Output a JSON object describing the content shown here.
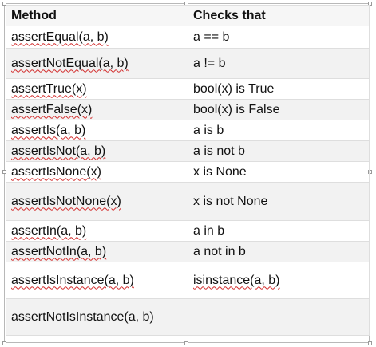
{
  "table": {
    "headers": [
      "Method",
      "Checks that"
    ],
    "rows": [
      {
        "method": "assertEqual(a, b)",
        "check": "a == b"
      },
      {
        "method": "assertNotEqual(a, b)",
        "check": "a != b"
      },
      {
        "method": "assertTrue(x)",
        "check": "bool(x) is True"
      },
      {
        "method": "assertFalse(x)",
        "check": "bool(x) is False"
      },
      {
        "method": "assertIs(a, b)",
        "check": "a is b"
      },
      {
        "method": "assertIsNot(a, b)",
        "check": "a is not b"
      },
      {
        "method": "assertIsNone(x)",
        "check": "x is None"
      },
      {
        "method": "assertIsNotNone(x)",
        "check": "x is not None"
      },
      {
        "method": "assertIn(a, b)",
        "check": "a in b"
      },
      {
        "method": "assertNotIn(a, b)",
        "check": "a not in b"
      },
      {
        "method": "assertIsInstance(a, b)",
        "check": "isinstance(a, b)"
      },
      {
        "method": "assertNotIsInstance(a, b)",
        "check": ""
      }
    ]
  },
  "colors": {
    "spellcheck_underline": "#d22b2b",
    "grid_line": "#dedede",
    "selection_frame": "#b8b8b8"
  }
}
